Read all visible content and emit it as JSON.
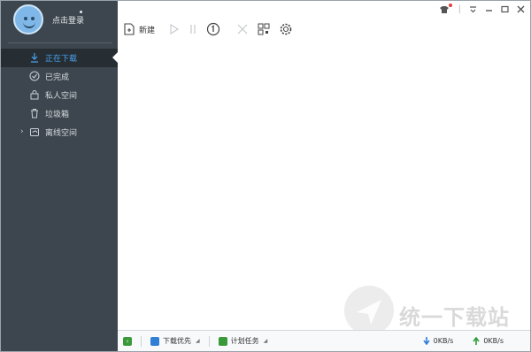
{
  "profile": {
    "login_text": "点击登录"
  },
  "sidebar": {
    "items": [
      {
        "label": "正在下载",
        "icon": "download-icon",
        "active": true
      },
      {
        "label": "已完成",
        "icon": "check-circle-icon",
        "active": false
      },
      {
        "label": "私人空间",
        "icon": "lock-icon",
        "active": false
      },
      {
        "label": "垃圾箱",
        "icon": "trash-icon",
        "active": false
      },
      {
        "label": "离线空间",
        "icon": "cloud-folder-icon",
        "active": false,
        "expandable": true
      }
    ]
  },
  "toolbar": {
    "new_label": "新建"
  },
  "bottom": {
    "download_priority": "下载优先",
    "schedule_task": "计划任务",
    "download_speed": "0KB/s",
    "upload_speed": "0KB/s"
  },
  "watermark": {
    "text": "统一下载站"
  },
  "colors": {
    "sidebar_bg": "#3d464e",
    "active_blue": "#4aa3f0",
    "download_arrow": "#2f7fd6",
    "upload_arrow": "#2e9a3a"
  }
}
